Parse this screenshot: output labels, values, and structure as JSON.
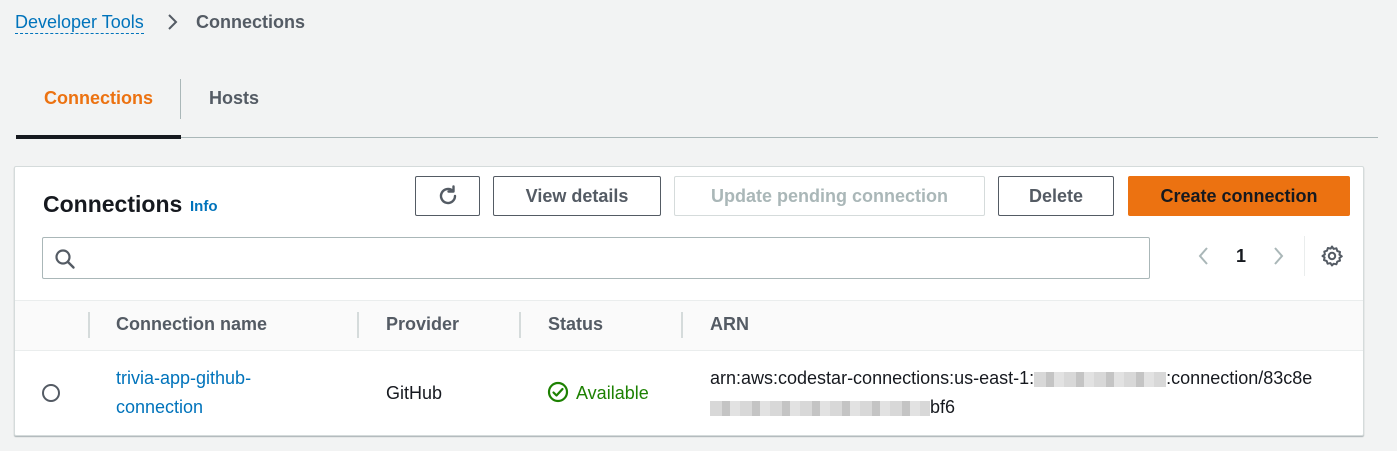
{
  "breadcrumb": {
    "root": "Developer Tools",
    "current": "Connections"
  },
  "tabs": [
    {
      "label": "Connections",
      "active": true
    },
    {
      "label": "Hosts",
      "active": false
    }
  ],
  "panel": {
    "title": "Connections",
    "info": "Info",
    "buttons": {
      "view_details": "View details",
      "update_pending": "Update pending connection",
      "delete": "Delete",
      "create": "Create connection"
    },
    "search": {
      "placeholder": "",
      "value": ""
    },
    "pagination": {
      "page": "1"
    }
  },
  "table": {
    "columns": [
      "Connection name",
      "Provider",
      "Status",
      "ARN"
    ],
    "rows": [
      {
        "name": "trivia-app-github-connection",
        "provider": "GitHub",
        "status": "Available",
        "arn_prefix": "arn:aws:codestar-connections:us-east-1:",
        "arn_mid": ":connection/83c8e",
        "arn_suffix": "bf6"
      }
    ]
  },
  "colors": {
    "accent": "#ec7211",
    "link": "#0073bb",
    "success": "#1d8102"
  }
}
